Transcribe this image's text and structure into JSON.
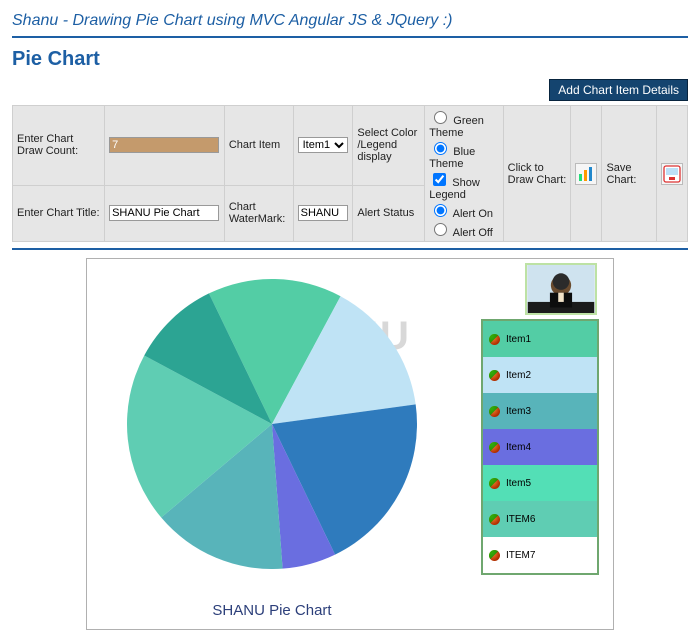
{
  "header": {
    "title": "Shanu - Drawing Pie Chart using MVC Angular JS & JQuery :)",
    "subtitle": "Pie Chart",
    "add_button": "Add Chart Item Details"
  },
  "controls": {
    "count_label": "Enter Chart Draw Count:",
    "count_value": "7",
    "title_label": "Enter Chart Title:",
    "title_value": "SHANU Pie Chart",
    "item_label": "Chart Item",
    "item_value": "Item1",
    "watermark_label": "Chart WaterMark:",
    "watermark_value": "SHANU",
    "colorlegend_label": "Select Color /Legend display",
    "alertstatus_label": "Alert Status",
    "opts": {
      "green_theme": "Green Theme",
      "blue_theme": "Blue Theme",
      "show_legend": "Show Legend",
      "alert_on": "Alert On",
      "alert_off": "Alert Off"
    },
    "opts_state": {
      "theme": "blue",
      "show_legend": true,
      "alert": "on"
    },
    "draw_label": "Click to Draw Chart:",
    "save_label": "Save Chart:"
  },
  "chart_data": {
    "type": "pie",
    "title": "SHANU Pie Chart",
    "watermark": "SHANU",
    "series": [
      {
        "name": "Item1",
        "value": 15,
        "color": "#53cda5"
      },
      {
        "name": "Item2",
        "value": 15,
        "color": "#bfe3f5"
      },
      {
        "name": "Item3",
        "value": 20,
        "color": "#2f7bbd"
      },
      {
        "name": "Item4",
        "value": 6,
        "color": "#6a6ee0"
      },
      {
        "name": "Item5",
        "value": 15,
        "color": "#58b4ba"
      },
      {
        "name": "ITEM6",
        "value": 19,
        "color": "#5fcdb3"
      },
      {
        "name": "ITEM7",
        "value": 10,
        "color": "#2ca493"
      }
    ],
    "legend": [
      {
        "name": "Item1",
        "bg": "#53cda5"
      },
      {
        "name": "Item2",
        "bg": "#bfe3f5"
      },
      {
        "name": "Item3",
        "bg": "#58b4ba"
      },
      {
        "name": "Item4",
        "bg": "#6a6ee0"
      },
      {
        "name": "Item5",
        "bg": "#53dfb6"
      },
      {
        "name": "ITEM6",
        "bg": "#5fcdb3"
      },
      {
        "name": "ITEM7",
        "bg": "#ffffff"
      }
    ]
  }
}
